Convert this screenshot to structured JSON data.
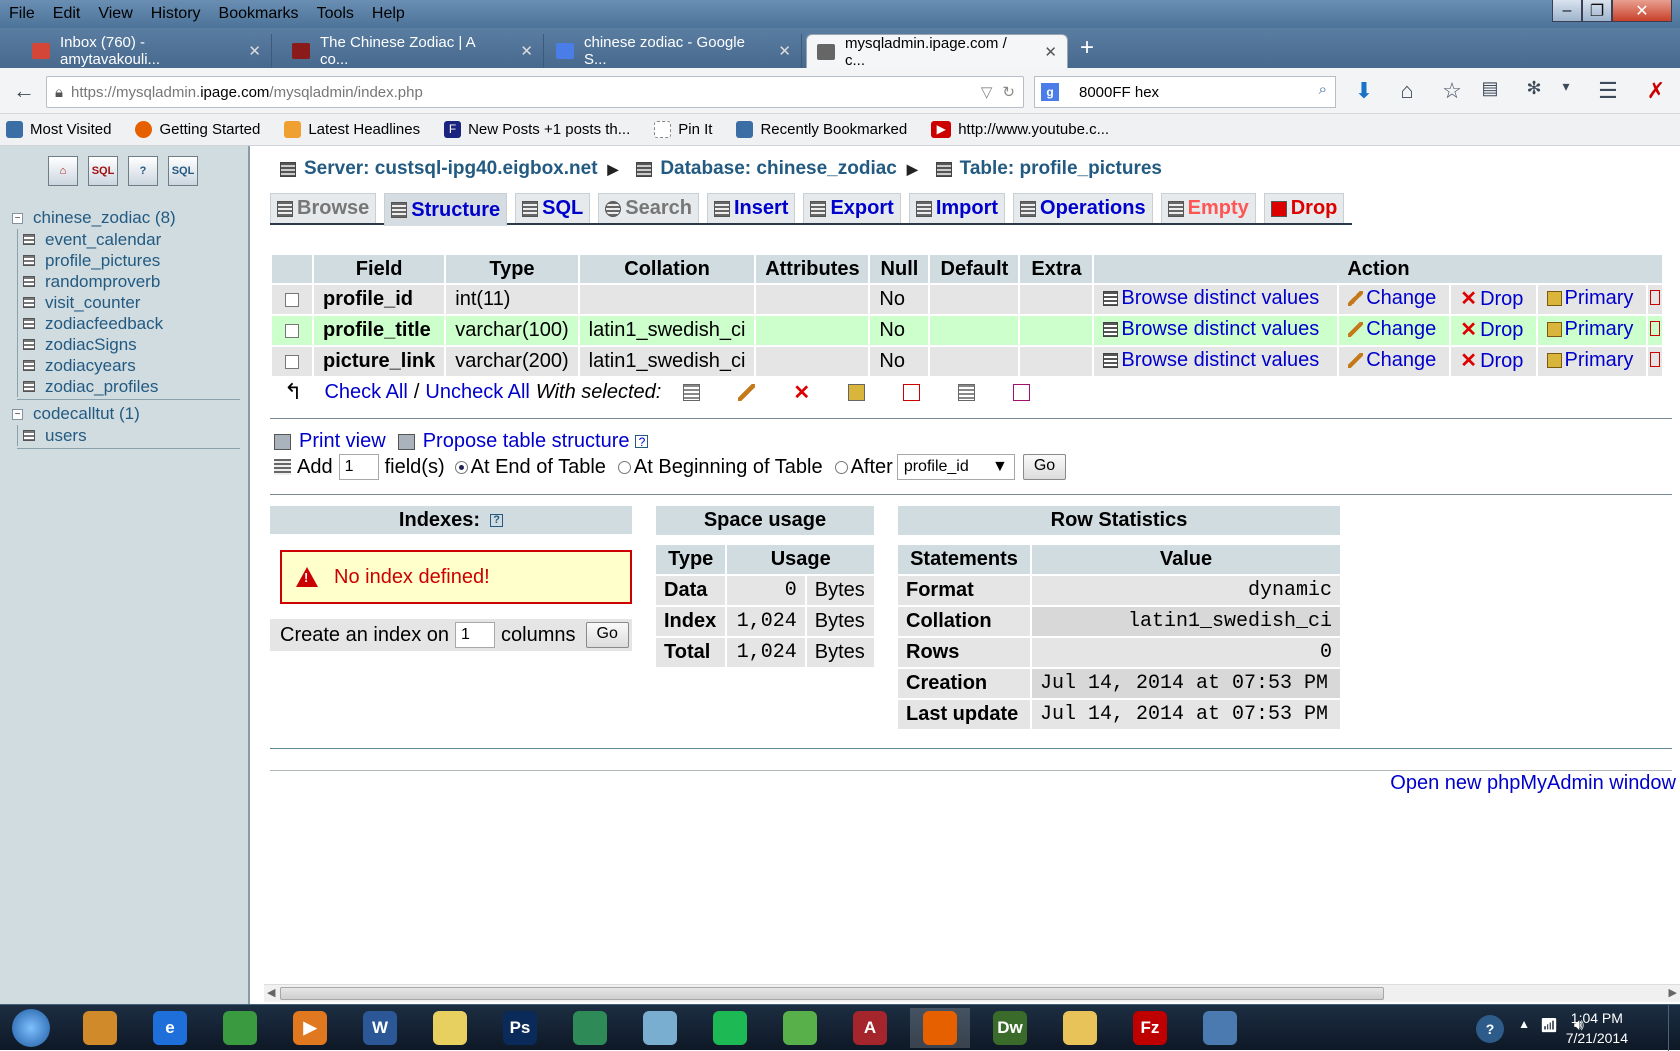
{
  "menu": [
    "File",
    "Edit",
    "View",
    "History",
    "Bookmarks",
    "Tools",
    "Help"
  ],
  "browser_tabs": [
    {
      "label": "Inbox (760) - amytavakouli...",
      "color": "#d44638"
    },
    {
      "label": "The Chinese Zodiac | A co...",
      "color": "#8b1a1a"
    },
    {
      "label": "chinese zodiac - Google S...",
      "color": "#4a7de8"
    },
    {
      "label": "mysqladmin.ipage.com / c...",
      "color": "#666666"
    }
  ],
  "address": {
    "prefix": "https://mysqladmin.",
    "domain": "ipage.com",
    "suffix": "/mysqladmin/index.php"
  },
  "search_value": "8000FF hex",
  "bookmarks": [
    {
      "label": "Most Visited",
      "color": "#3a6ea5"
    },
    {
      "label": "Getting Started",
      "color": "#e66000"
    },
    {
      "label": "Latest Headlines",
      "color": "#f0a030"
    },
    {
      "label": "New Posts +1 posts th...",
      "color": "#1a237e"
    },
    {
      "label": "Pin It",
      "color": "#ffffff"
    },
    {
      "label": "Recently Bookmarked",
      "color": "#3a6ea5"
    },
    {
      "label": "http://www.youtube.c...",
      "color": "#cc0000"
    }
  ],
  "left_icons": [
    "home-icon",
    "sql-icon",
    "help-icon",
    "query-icon"
  ],
  "left_icon_text": [
    "⌂",
    "SQL",
    "?",
    "SQL"
  ],
  "tree": {
    "db1": "chinese_zodiac (8)",
    "db1_tables": [
      "event_calendar",
      "profile_pictures",
      "randomproverb",
      "visit_counter",
      "zodiacfeedback",
      "zodiacSigns",
      "zodiacyears",
      "zodiac_profiles"
    ],
    "db2": "codecalltut (1)",
    "db2_tables": [
      "users"
    ]
  },
  "breadcrumb": {
    "server": "Server: custsql-ipg40.eigbox.net",
    "database": "Database: chinese_zodiac",
    "table": "Table: profile_pictures"
  },
  "tabs": [
    "Browse",
    "Structure",
    "SQL",
    "Search",
    "Insert",
    "Export",
    "Import",
    "Operations",
    "Empty",
    "Drop"
  ],
  "columns": [
    "Field",
    "Type",
    "Collation",
    "Attributes",
    "Null",
    "Default",
    "Extra",
    "Action"
  ],
  "rows": [
    {
      "field": "profile_id",
      "type": "int(11)",
      "collation": "",
      "null": "No"
    },
    {
      "field": "profile_title",
      "type": "varchar(100)",
      "collation": "latin1_swedish_ci",
      "null": "No"
    },
    {
      "field": "picture_link",
      "type": "varchar(200)",
      "collation": "latin1_swedish_ci",
      "null": "No"
    }
  ],
  "actions": {
    "browse": "Browse distinct values",
    "change": "Change",
    "drop": "Drop",
    "primary": "Primary"
  },
  "check": {
    "check_all": "Check All",
    "sep": "/",
    "uncheck_all": "Uncheck All",
    "with_selected": "With selected:"
  },
  "print_view": "Print view",
  "propose": "Propose table structure",
  "add": {
    "label": "Add",
    "value": "1",
    "fields": "field(s)",
    "end": "At End of Table",
    "begin": "At Beginning of Table",
    "after": "After",
    "after_value": "profile_id",
    "go": "Go"
  },
  "indexes": {
    "title": "Indexes:",
    "none": "No index defined!",
    "create_prefix": "Create an index on",
    "create_value": "1",
    "create_suffix": "columns",
    "go": "Go"
  },
  "space": {
    "title": "Space usage",
    "headers": [
      "Type",
      "Usage"
    ],
    "rows": [
      [
        "Data",
        "0",
        "Bytes"
      ],
      [
        "Index",
        "1,024",
        "Bytes"
      ],
      [
        "Total",
        "1,024",
        "Bytes"
      ]
    ]
  },
  "rowstats": {
    "title": "Row Statistics",
    "headers": [
      "Statements",
      "Value"
    ],
    "rows": [
      [
        "Format",
        "dynamic"
      ],
      [
        "Collation",
        "latin1_swedish_ci"
      ],
      [
        "Rows",
        "0"
      ],
      [
        "Creation",
        "Jul 14, 2014 at 07:53 PM"
      ],
      [
        "Last update",
        "Jul 14, 2014 at 07:53 PM"
      ]
    ]
  },
  "open_window": "Open new phpMyAdmin window",
  "clock": {
    "time": "1:04 PM",
    "date": "7/21/2014"
  },
  "taskbar": [
    {
      "name": "paint-icon",
      "color": "#d08a2a",
      "text": ""
    },
    {
      "name": "ie-icon",
      "color": "#1e6fd9",
      "text": "e"
    },
    {
      "name": "chrome-icon",
      "color": "#3a9a40",
      "text": ""
    },
    {
      "name": "media-icon",
      "color": "#e07820",
      "text": "▶"
    },
    {
      "name": "word-icon",
      "color": "#2b5797",
      "text": "W"
    },
    {
      "name": "notes-icon",
      "color": "#e8d060",
      "text": ""
    },
    {
      "name": "photoshop-icon",
      "color": "#0a2a5a",
      "text": "Ps"
    },
    {
      "name": "publisher-icon",
      "color": "#2e8b57",
      "text": ""
    },
    {
      "name": "onenote-icon",
      "color": "#7aaed0",
      "text": ""
    },
    {
      "name": "spotify-icon",
      "color": "#1db954",
      "text": ""
    },
    {
      "name": "game-icon",
      "color": "#58b04a",
      "text": ""
    },
    {
      "name": "access-icon",
      "color": "#a4262c",
      "text": "A"
    },
    {
      "name": "firefox-icon",
      "color": "#e66000",
      "text": ""
    },
    {
      "name": "dreamweaver-icon",
      "color": "#3b6b2a",
      "text": "Dw"
    },
    {
      "name": "explorer-icon",
      "color": "#e7c35a",
      "text": ""
    },
    {
      "name": "filezilla-icon",
      "color": "#bf0000",
      "text": "Fz"
    },
    {
      "name": "remote-icon",
      "color": "#4a7ab0",
      "text": ""
    }
  ]
}
